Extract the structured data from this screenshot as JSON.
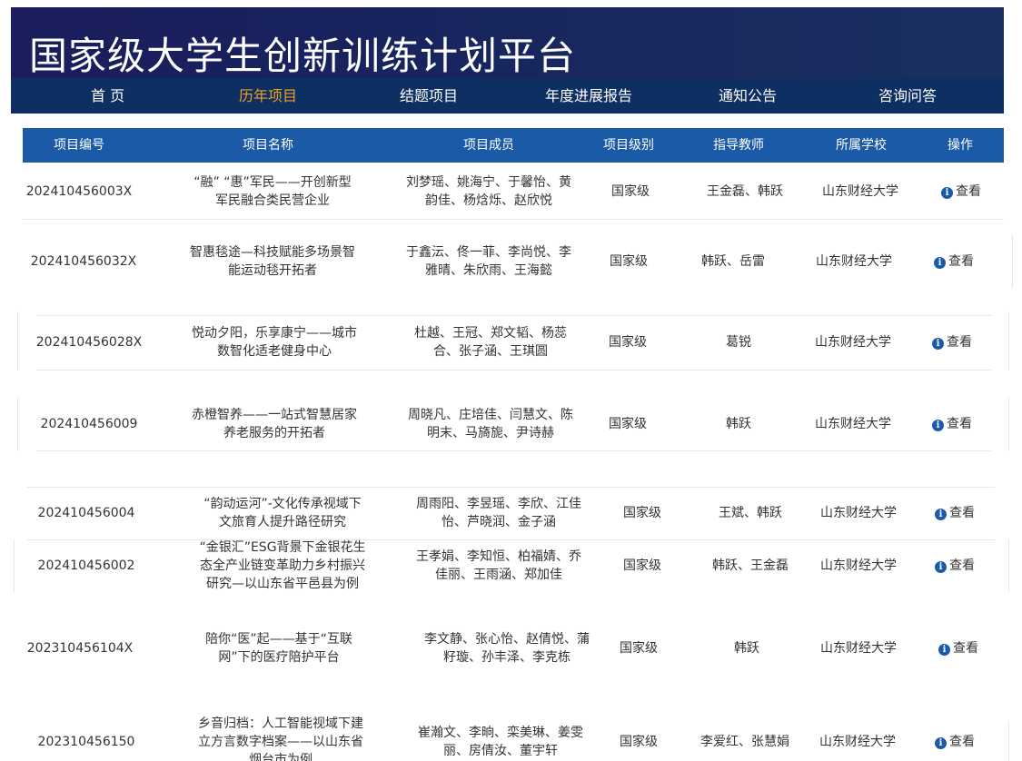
{
  "header": {
    "title": "国家级大学生创新训练计划平台"
  },
  "nav": {
    "items": [
      {
        "label": "首 页"
      },
      {
        "label": "历年项目"
      },
      {
        "label": "结题项目"
      },
      {
        "label": "年度进展报告"
      },
      {
        "label": "通知公告"
      },
      {
        "label": "咨询问答"
      }
    ],
    "active_index": 1
  },
  "table": {
    "columns": [
      "项目编号",
      "项目名称",
      "项目成员",
      "项目级别",
      "指导教师",
      "所属学校",
      "操作"
    ],
    "action_label": "查看",
    "rows": [
      {
        "code": "202410456003X",
        "name": "“融” “惠”军民——开创新型军民融合类民营企业",
        "members": "刘梦瑶、姚海宁、于馨怡、黄韵佳、杨焓烁、赵欣悦",
        "level": "国家级",
        "teacher": "王金磊、韩跃",
        "school": "山东财经大学"
      },
      {
        "code": "202410456032X",
        "name": "智惠毯途—科技赋能多场景智能运动毯开拓者",
        "members": "于鑫沄、佟一菲、李尚悦、李雅晴、朱欣雨、王海懿",
        "level": "国家级",
        "teacher": "韩跃、岳雷",
        "school": "山东财经大学"
      },
      {
        "code": "202410456028X",
        "name": "悦动夕阳，乐享康宁——城市数智化适老健身中心",
        "members": "杜越、王冠、郑文韬、杨蕊合、张子涵、王琪圆",
        "level": "国家级",
        "teacher": "葛锐",
        "school": "山东财经大学"
      },
      {
        "code": "202410456009",
        "name": "赤橙智养——一站式智慧居家养老服务的开拓者",
        "members": "周晓凡、庄培佳、闫慧文、陈明末、马旖旎、尹诗赫",
        "level": "国家级",
        "teacher": "韩跃",
        "school": "山东财经大学"
      },
      {
        "code": "202410456004",
        "name": "“韵动运河”-文化传承视域下文旅育人提升路径研究",
        "members": "周雨阳、李昱瑶、李欣、江佳怡、芦晓润、金子涵",
        "level": "国家级",
        "teacher": "王斌、韩跃",
        "school": "山东财经大学"
      },
      {
        "code": "202410456002",
        "name": "“金银汇”ESG背景下金银花生态全产业链变革助力乡村振兴研究—以山东省平邑县为例",
        "members": "王孝娟、李知恒、柏福婧、乔佳丽、王雨涵、郑加佳",
        "level": "国家级",
        "teacher": "韩跃、王金磊",
        "school": "山东财经大学"
      },
      {
        "code": "202310456104X",
        "name": "陪你“医”起——基于“互联网”下的医疗陪护平台",
        "members": "李文静、张心怡、赵倩悦、蒲籽璇、孙丰泽、李克栋",
        "level": "国家级",
        "teacher": "韩跃",
        "school": "山东财经大学"
      },
      {
        "code": "202310456150",
        "name": "乡音归档：人工智能视域下建立方言数字档案——以山东省烟台市为例",
        "members": "崔瀚文、李晌、栾美琳、姜雯丽、房倩汝、董宇轩",
        "level": "国家级",
        "teacher": "李爱红、张慧娟",
        "school": "山东财经大学"
      }
    ]
  }
}
